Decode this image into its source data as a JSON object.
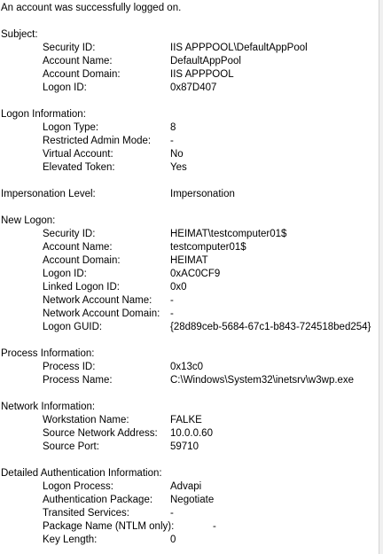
{
  "header": "An account was successfully logged on.",
  "sections": [
    {
      "title": "Subject:",
      "fields": [
        {
          "label": "Security ID:",
          "value": "IIS APPPOOL\\DefaultAppPool"
        },
        {
          "label": "Account Name:",
          "value": "DefaultAppPool"
        },
        {
          "label": "Account Domain:",
          "value": "IIS APPPOOL"
        },
        {
          "label": "Logon ID:",
          "value": "0x87D407"
        }
      ]
    },
    {
      "title": "Logon Information:",
      "fields": [
        {
          "label": "Logon Type:",
          "value": "8"
        },
        {
          "label": "Restricted Admin Mode:",
          "value": "-"
        },
        {
          "label": "Virtual Account:",
          "value": "No"
        },
        {
          "label": "Elevated Token:",
          "value": "Yes"
        }
      ]
    },
    {
      "title": "Impersonation Level:",
      "inline_value": "Impersonation",
      "fields": []
    },
    {
      "title": "New Logon:",
      "fields": [
        {
          "label": "Security ID:",
          "value": "HEIMAT\\testcomputer01$"
        },
        {
          "label": "Account Name:",
          "value": "testcomputer01$"
        },
        {
          "label": "Account Domain:",
          "value": "HEIMAT"
        },
        {
          "label": "Logon ID:",
          "value": "0xAC0CF9"
        },
        {
          "label": "Linked Logon ID:",
          "value": "0x0"
        },
        {
          "label": "Network Account Name:",
          "value": "-"
        },
        {
          "label": "Network Account Domain:",
          "value": "-"
        },
        {
          "label": "Logon GUID:",
          "value": "{28d89ceb-5684-67c1-b843-724518bed254}"
        }
      ]
    },
    {
      "title": "Process Information:",
      "fields": [
        {
          "label": "Process ID:",
          "value": "0x13c0"
        },
        {
          "label": "Process Name:",
          "value": "C:\\Windows\\System32\\inetsrv\\w3wp.exe"
        }
      ]
    },
    {
      "title": "Network Information:",
      "fields": [
        {
          "label": "Workstation Name:",
          "value": "FALKE"
        },
        {
          "label": "Source Network Address:",
          "value": "10.0.0.60"
        },
        {
          "label": "Source Port:",
          "value": "59710"
        }
      ]
    },
    {
      "title": "Detailed Authentication Information:",
      "fields": [
        {
          "label": "Logon Process:",
          "value": "Advapi"
        },
        {
          "label": "Authentication Package:",
          "value": "Negotiate"
        },
        {
          "label": "Transited Services:",
          "value": "-"
        },
        {
          "label": "Package Name (NTLM only):",
          "value": "-"
        },
        {
          "label": "Key Length:",
          "value": "0"
        }
      ]
    }
  ]
}
